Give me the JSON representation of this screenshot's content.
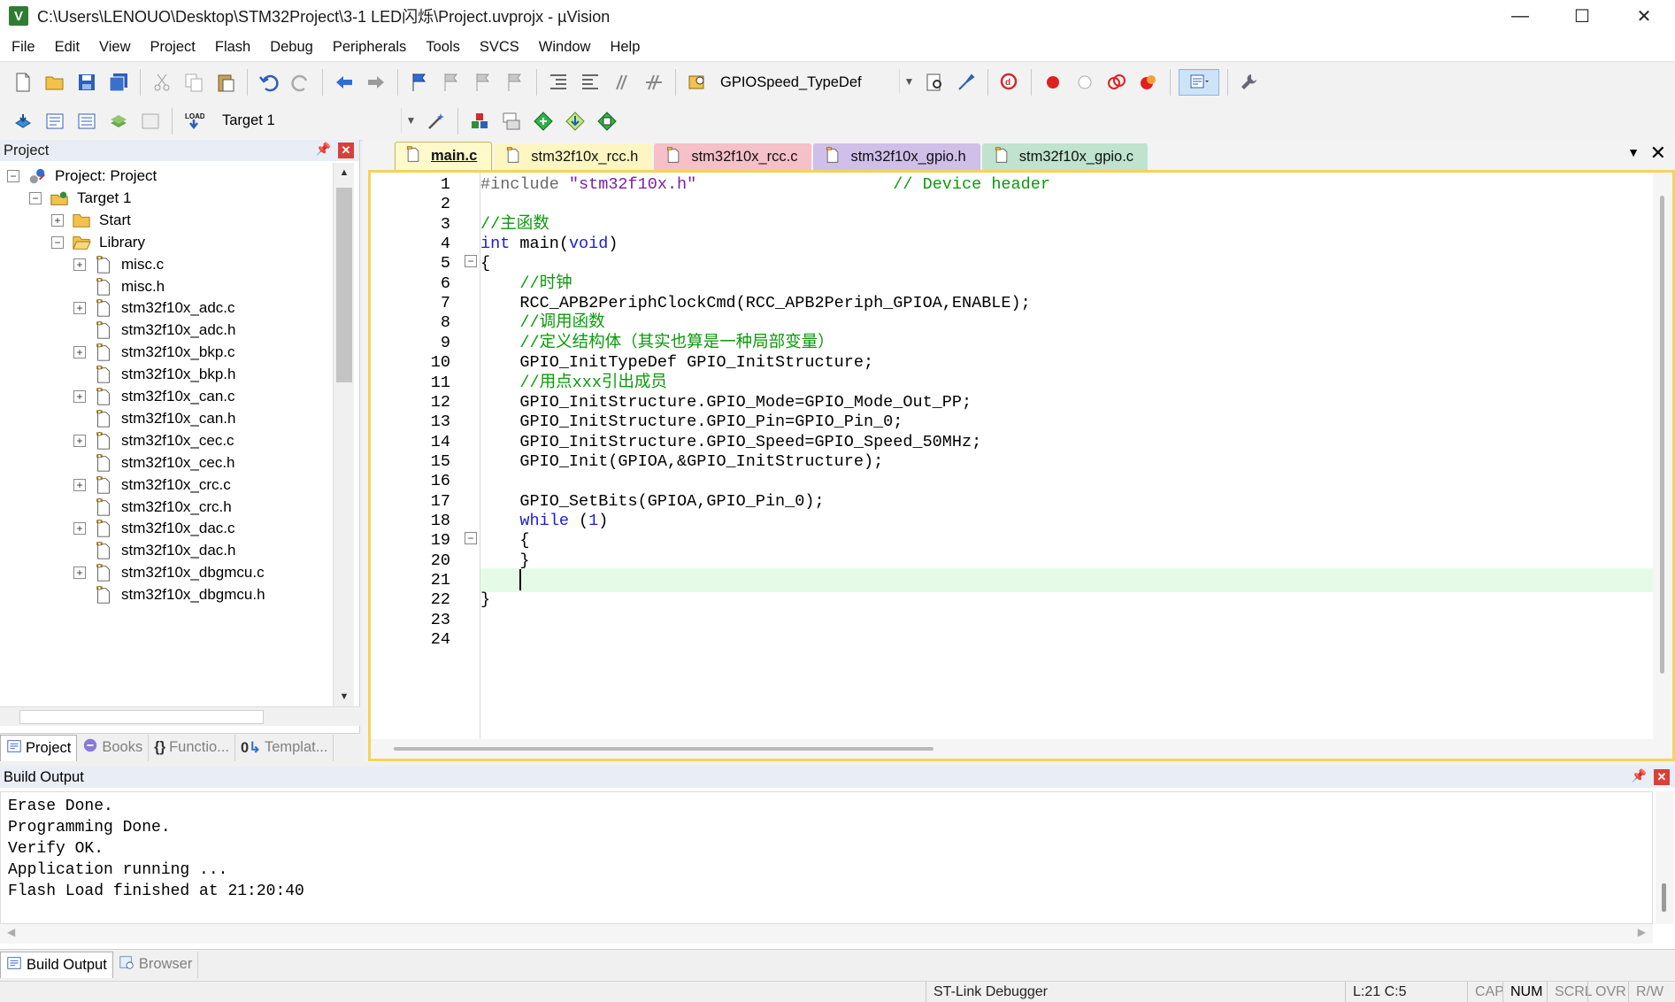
{
  "window": {
    "title": "C:\\Users\\LENOUO\\Desktop\\STM32Project\\3-1 LED闪烁\\Project.uvprojx - µVision",
    "app_icon": "V",
    "minimize": "—",
    "maximize": "☐",
    "close": "✕"
  },
  "menu": [
    "File",
    "Edit",
    "View",
    "Project",
    "Flash",
    "Debug",
    "Peripherals",
    "Tools",
    "SVCS",
    "Window",
    "Help"
  ],
  "toolbar": {
    "find_combo_value": "GPIOSpeed_TypeDef",
    "target_combo_value": "Target 1"
  },
  "project_panel": {
    "title": "Project",
    "tree": [
      {
        "label": "Project: Project",
        "level": 0,
        "expander": "−",
        "icon": "project-icon"
      },
      {
        "label": "Target 1",
        "level": 1,
        "expander": "−",
        "icon": "target-icon"
      },
      {
        "label": "Start",
        "level": 2,
        "expander": "+",
        "icon": "folder-icon"
      },
      {
        "label": "Library",
        "level": 2,
        "expander": "−",
        "icon": "folder-open-icon"
      },
      {
        "label": "misc.c",
        "level": 3,
        "expander": "+",
        "icon": "file-icon"
      },
      {
        "label": "misc.h",
        "level": 3,
        "expander": "",
        "icon": "file-icon"
      },
      {
        "label": "stm32f10x_adc.c",
        "level": 3,
        "expander": "+",
        "icon": "file-icon"
      },
      {
        "label": "stm32f10x_adc.h",
        "level": 3,
        "expander": "",
        "icon": "file-icon"
      },
      {
        "label": "stm32f10x_bkp.c",
        "level": 3,
        "expander": "+",
        "icon": "file-icon"
      },
      {
        "label": "stm32f10x_bkp.h",
        "level": 3,
        "expander": "",
        "icon": "file-icon"
      },
      {
        "label": "stm32f10x_can.c",
        "level": 3,
        "expander": "+",
        "icon": "file-icon"
      },
      {
        "label": "stm32f10x_can.h",
        "level": 3,
        "expander": "",
        "icon": "file-icon"
      },
      {
        "label": "stm32f10x_cec.c",
        "level": 3,
        "expander": "+",
        "icon": "file-icon"
      },
      {
        "label": "stm32f10x_cec.h",
        "level": 3,
        "expander": "",
        "icon": "file-icon"
      },
      {
        "label": "stm32f10x_crc.c",
        "level": 3,
        "expander": "+",
        "icon": "file-icon"
      },
      {
        "label": "stm32f10x_crc.h",
        "level": 3,
        "expander": "",
        "icon": "file-icon"
      },
      {
        "label": "stm32f10x_dac.c",
        "level": 3,
        "expander": "+",
        "icon": "file-icon"
      },
      {
        "label": "stm32f10x_dac.h",
        "level": 3,
        "expander": "",
        "icon": "file-icon"
      },
      {
        "label": "stm32f10x_dbgmcu.c",
        "level": 3,
        "expander": "+",
        "icon": "file-icon"
      },
      {
        "label": "stm32f10x_dbgmcu.h",
        "level": 3,
        "expander": "",
        "icon": "file-icon"
      }
    ],
    "tabs": [
      {
        "label": "Project",
        "icon": "project-tab-icon",
        "active": true
      },
      {
        "label": "Books",
        "icon": "books-icon",
        "active": false
      },
      {
        "label": "Functio...",
        "icon": "functions-icon",
        "active": false
      },
      {
        "label": "Templat...",
        "icon": "templates-icon",
        "active": false
      }
    ]
  },
  "editor": {
    "tabs": [
      {
        "label": "main.c",
        "style": "active"
      },
      {
        "label": "stm32f10x_rcc.h",
        "style": "t-yellow"
      },
      {
        "label": "stm32f10x_rcc.c",
        "style": "t-pink"
      },
      {
        "label": "stm32f10x_gpio.h",
        "style": "t-purple"
      },
      {
        "label": "stm32f10x_gpio.c",
        "style": "t-green"
      }
    ],
    "current_line": 21,
    "lines": [
      [
        {
          "t": "#include ",
          "c": "pp"
        },
        {
          "t": "\"stm32f10x.h\"",
          "c": "str"
        },
        {
          "t": "                    ",
          "c": ""
        },
        {
          "t": "// Device header",
          "c": "com"
        }
      ],
      [],
      [
        {
          "t": "//主函数",
          "c": "com"
        }
      ],
      [
        {
          "t": "int",
          "c": "kw"
        },
        {
          "t": " main(",
          "c": ""
        },
        {
          "t": "void",
          "c": "kw"
        },
        {
          "t": ")",
          "c": ""
        }
      ],
      [
        {
          "t": "{",
          "c": ""
        }
      ],
      [
        {
          "t": "    ",
          "c": ""
        },
        {
          "t": "//时钟",
          "c": "com"
        }
      ],
      [
        {
          "t": "    RCC_APB2PeriphClockCmd(RCC_APB2Periph_GPIOA,ENABLE);",
          "c": ""
        }
      ],
      [
        {
          "t": "    ",
          "c": ""
        },
        {
          "t": "//调用函数",
          "c": "com"
        }
      ],
      [
        {
          "t": "    ",
          "c": ""
        },
        {
          "t": "//定义结构体（其实也算是一种局部变量）",
          "c": "com"
        }
      ],
      [
        {
          "t": "    GPIO_InitTypeDef GPIO_InitStructure;",
          "c": ""
        }
      ],
      [
        {
          "t": "    ",
          "c": ""
        },
        {
          "t": "//用点xxx引出成员",
          "c": "com"
        }
      ],
      [
        {
          "t": "    GPIO_InitStructure.GPIO_Mode=GPIO_Mode_Out_PP;",
          "c": ""
        }
      ],
      [
        {
          "t": "    GPIO_InitStructure.GPIO_Pin=GPIO_Pin_0;",
          "c": ""
        }
      ],
      [
        {
          "t": "    GPIO_InitStructure.GPIO_Speed=GPIO_Speed_50MHz;",
          "c": ""
        }
      ],
      [
        {
          "t": "    GPIO_Init(GPIOA,&GPIO_InitStructure);",
          "c": ""
        }
      ],
      [],
      [
        {
          "t": "    GPIO_SetBits(GPIOA,GPIO_Pin_0);",
          "c": ""
        }
      ],
      [
        {
          "t": "    ",
          "c": ""
        },
        {
          "t": "while",
          "c": "kw"
        },
        {
          "t": " (",
          "c": ""
        },
        {
          "t": "1",
          "c": "num"
        },
        {
          "t": ")",
          "c": ""
        }
      ],
      [
        {
          "t": "    {",
          "c": ""
        }
      ],
      [
        {
          "t": "    }",
          "c": ""
        }
      ],
      [
        {
          "t": "    ",
          "c": ""
        }
      ],
      [
        {
          "t": "}",
          "c": ""
        }
      ],
      [],
      []
    ],
    "fold_markers": [
      5,
      19
    ],
    "line_numbers": [
      "1",
      "2",
      "3",
      "4",
      "5",
      "6",
      "7",
      "8",
      "9",
      "10",
      "11",
      "12",
      "13",
      "14",
      "15",
      "16",
      "17",
      "18",
      "19",
      "20",
      "21",
      "22",
      "23",
      "24"
    ]
  },
  "build_output": {
    "title": "Build Output",
    "lines": [
      "Erase Done.",
      "Programming Done.",
      "Verify OK.",
      "Application running ...",
      "Flash Load finished at 21:20:40"
    ],
    "tabs": [
      {
        "label": "Build Output",
        "active": true
      },
      {
        "label": "Browser",
        "active": false
      }
    ]
  },
  "status": {
    "debugger": "ST-Link Debugger",
    "position": "L:21 C:5",
    "flags": [
      {
        "label": "CAP",
        "on": false
      },
      {
        "label": "NUM",
        "on": true
      },
      {
        "label": "SCRL",
        "on": false
      },
      {
        "label": "OVR",
        "on": false
      },
      {
        "label": "R/W",
        "on": false
      }
    ]
  },
  "colors": {
    "comment": "#0a9a0a",
    "keyword": "#1c1cd8",
    "string": "#7a1fa8",
    "current_line": "#e6fbe7",
    "editor_border": "#f4d45a"
  }
}
